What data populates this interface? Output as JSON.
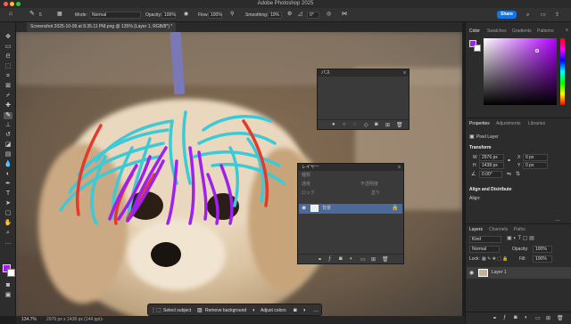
{
  "titlebar": {
    "title": "Adobe Photoshop 2025"
  },
  "options": {
    "mode_label": "Mode:",
    "mode_value": "Normal",
    "opacity_label": "Opacity:",
    "opacity_value": "100%",
    "flow_label": "Flow:",
    "flow_value": "100%",
    "smoothing_label": "Smoothing:",
    "smoothing_value": "10%",
    "angle_value": "0°",
    "brush_size": "5",
    "share_label": "Share"
  },
  "document": {
    "tab_title": "Screenshot 2025-10-09 at 8.35.11 PM.png @ 135% (Layer 1, RGB/8*) *"
  },
  "paths_panel": {
    "title": "パス"
  },
  "layers_float": {
    "title": "レイヤー",
    "kind": "種類",
    "mode": "通常",
    "opacity_label": "不透明度",
    "lock_label": "ロック",
    "fill_label": "塗り",
    "layer_name": "背景"
  },
  "dock": {
    "color_tabs": [
      "Color",
      "Swatches",
      "Gradients",
      "Patterns"
    ],
    "props_tabs": [
      "Properties",
      "Adjustments",
      "Libraries"
    ],
    "pixel_layer": "Pixel Layer",
    "transform": "Transform",
    "w_label": "W",
    "w_value": "2976 px",
    "h_label": "H",
    "h_value": "1438 px",
    "x_label": "X",
    "x_value": "0 px",
    "y_label": "Y",
    "y_value": "0 px",
    "angle_value": "0.00°",
    "align_title": "Align and Distribute",
    "align_label": "Align:",
    "layers_tabs": [
      "Layers",
      "Channels",
      "Paths"
    ],
    "kind_value": "Kind",
    "blend_value": "Normal",
    "opacity_label": "Opacity:",
    "opacity_value": "100%",
    "lock_label": "Lock:",
    "fill_label": "Fill:",
    "fill_value": "100%",
    "layer_name": "Layer 1"
  },
  "status": {
    "zoom": "134.7%",
    "dimensions": "2976 px x 1438 px (144 ppi)"
  },
  "taskbar": {
    "select_subject": "Select subject",
    "remove_background": "Remove background",
    "adjust_colors": "Adjust colors"
  },
  "colors": {
    "accent": "#1473e6",
    "foreground": "#a020f0",
    "background": "#ffffff"
  }
}
